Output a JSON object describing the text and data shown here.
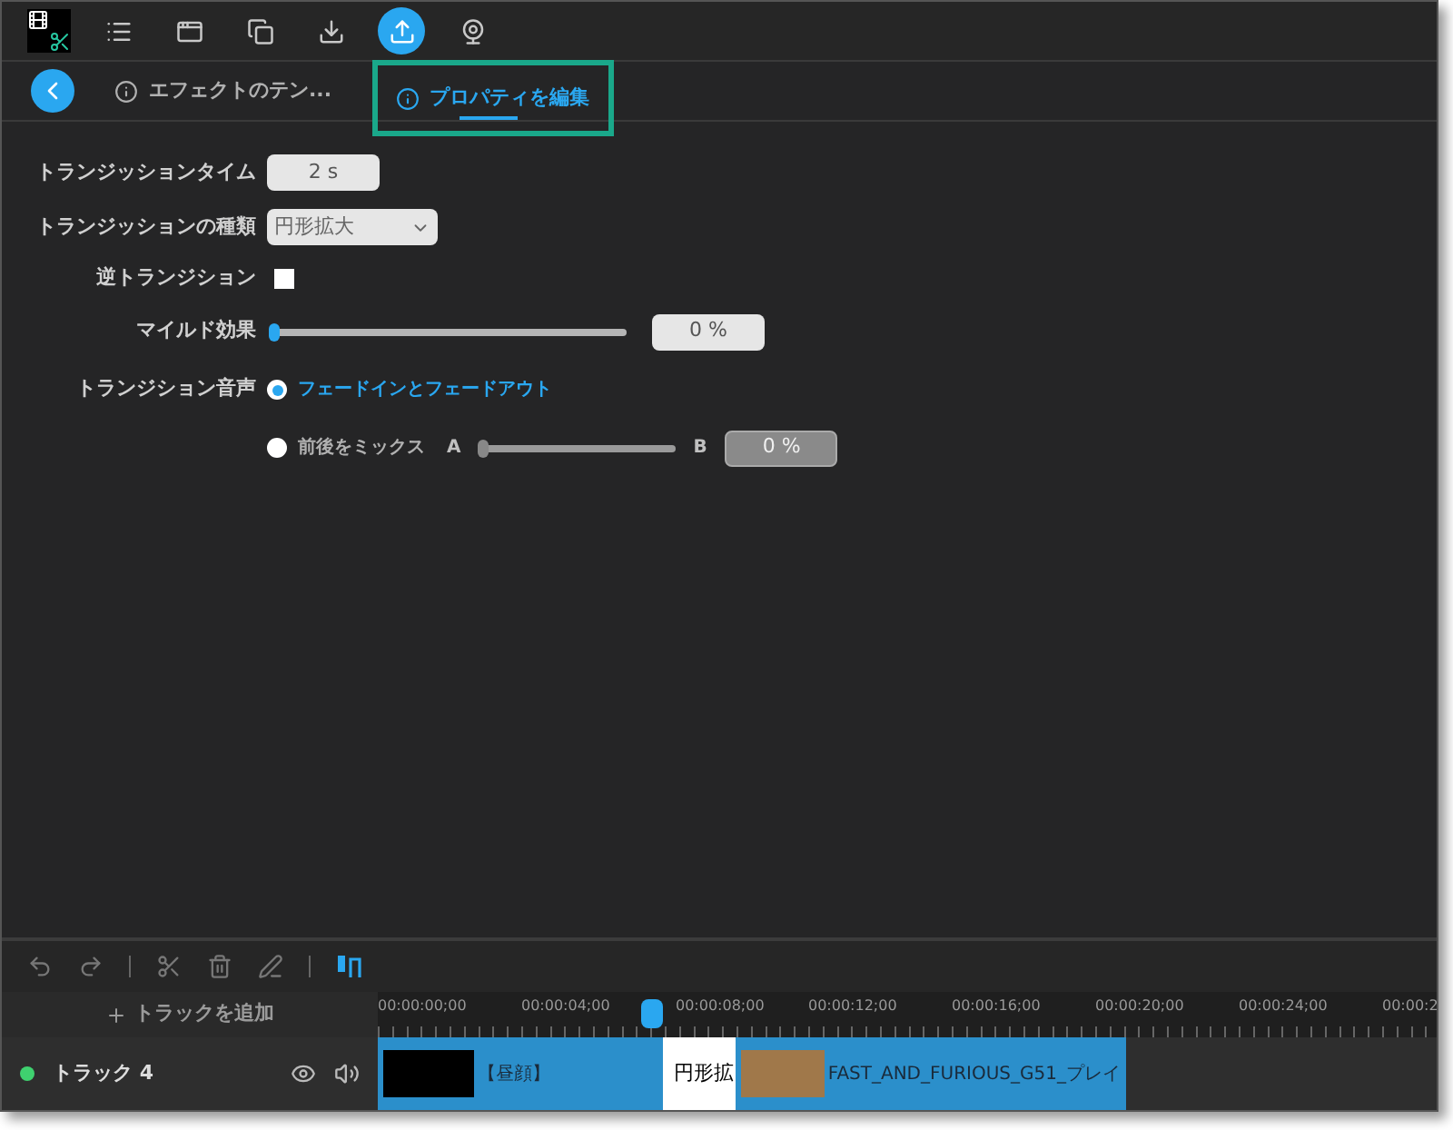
{
  "toolbar": {
    "icons": [
      {
        "kind": "logo",
        "selected": false
      },
      {
        "kind": "list",
        "selected": false
      },
      {
        "kind": "window",
        "selected": false
      },
      {
        "kind": "windows",
        "selected": false
      },
      {
        "kind": "download",
        "selected": false
      },
      {
        "kind": "upload",
        "selected": true
      },
      {
        "kind": "webcam",
        "selected": false
      }
    ]
  },
  "tabs": [
    {
      "label": "エフェクトのテン...",
      "selected": false
    },
    {
      "label": "プロパティを編集",
      "selected": true
    }
  ],
  "properties": {
    "time": {
      "label": "トランジッションタイム",
      "value": "2 s"
    },
    "type": {
      "label": "トランジッションの種類",
      "value": "円形拡大"
    },
    "reverse": {
      "label": "逆トランジション",
      "checked": false
    },
    "mild": {
      "label": "マイルド効果",
      "level": 0,
      "value": "0 %"
    },
    "audio": {
      "label": "トランジション音声",
      "options": [
        {
          "label": "フェードインとフェードアウト",
          "selected": true
        },
        {
          "label": "前後をミックス",
          "selected": false,
          "left": "A",
          "right": "B",
          "level": 0,
          "value": "0 %"
        }
      ]
    }
  },
  "timeline": {
    "add_track": "トラックを追加",
    "ticks": [
      "00:00:00;00",
      "00:00:04;00",
      "00:00:08;00",
      "00:00:12;00",
      "00:00:16;00",
      "00:00:20;00",
      "00:00:24;00",
      "00:00:2"
    ],
    "track": {
      "name": "トラック 4",
      "clips": [
        {
          "kind": "video",
          "title": "【昼顔】"
        },
        {
          "kind": "transition",
          "title": "円形拡"
        },
        {
          "kind": "video",
          "title": "FAST_AND_FURIOUS_G51_プレイ"
        }
      ]
    }
  }
}
